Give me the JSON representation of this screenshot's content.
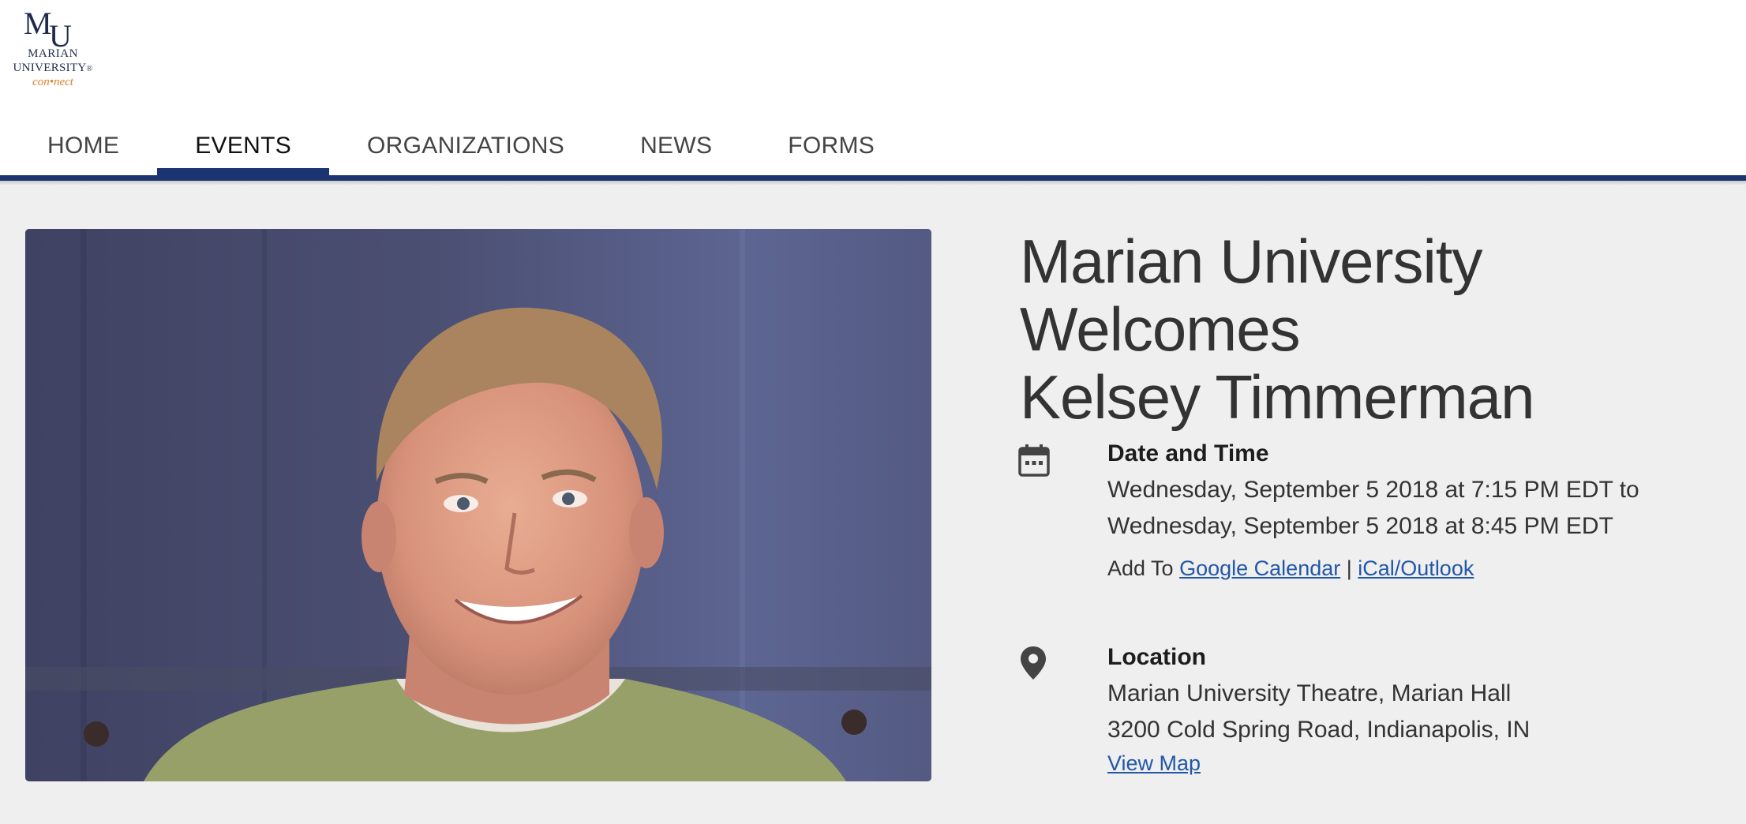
{
  "logo": {
    "mark": "MU",
    "line1": "MARIAN",
    "line2": "UNIVERSITY",
    "line3": "con•nect",
    "registered": "®"
  },
  "nav": {
    "tabs": [
      {
        "label": "HOME"
      },
      {
        "label": "EVENTS"
      },
      {
        "label": "ORGANIZATIONS"
      },
      {
        "label": "NEWS"
      },
      {
        "label": "FORMS"
      }
    ],
    "active_tab": "EVENTS"
  },
  "event": {
    "title_line1": "Marian University Welcomes",
    "title_line2": "Kelsey Timmerman",
    "date_time": {
      "heading": "Date and Time",
      "start": "Wednesday, September 5 2018 at 7:15 PM EDT to",
      "end": "Wednesday, September 5 2018 at 8:45 PM EDT",
      "add_to_label": "Add To",
      "google_calendar": "Google Calendar",
      "separator": "|",
      "ical_outlook": "iCal/Outlook"
    },
    "location": {
      "heading": "Location",
      "venue": "Marian University Theatre, Marian Hall",
      "address": "3200 Cold Spring Road, Indianapolis, IN",
      "view_map": "View Map"
    }
  },
  "colors": {
    "brand_navy": "#1a3570",
    "link_blue": "#2257a8",
    "page_bg": "#efefef",
    "logo_orange": "#d9822b"
  },
  "icons": {
    "date": "calendar-icon",
    "location": "map-pin-icon"
  }
}
